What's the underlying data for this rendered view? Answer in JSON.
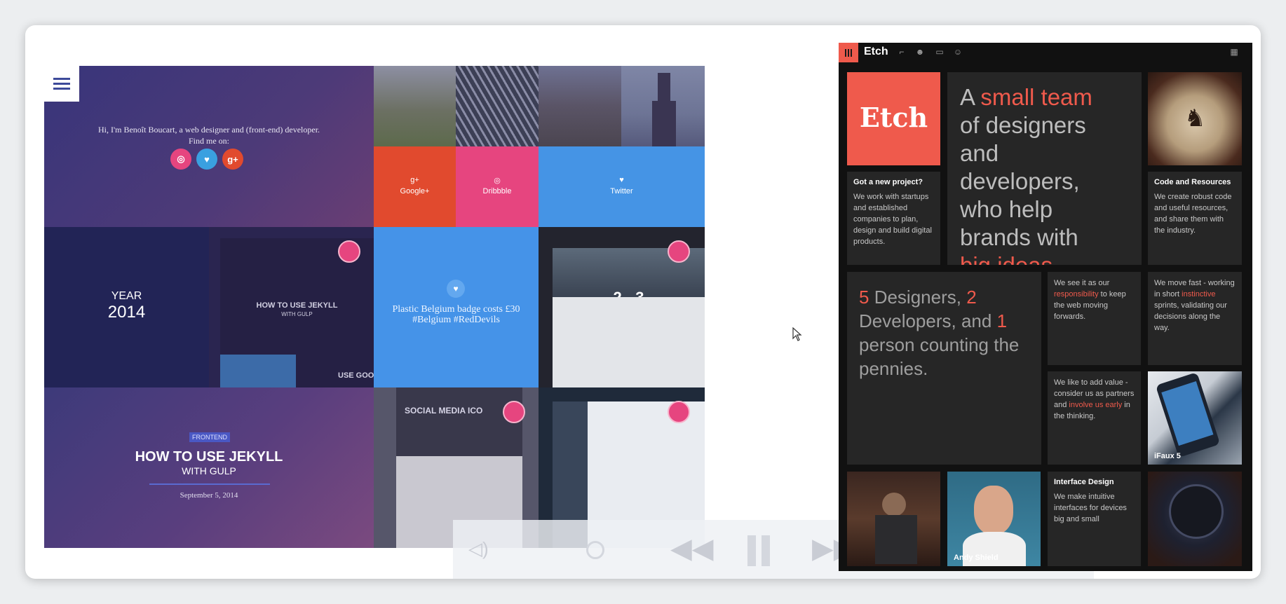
{
  "portfolio": {
    "intro_line1": "Hi, I'm Benoît Boucart, a web designer and (front-end) developer.",
    "intro_line2": "Find me on:",
    "social": [
      {
        "name": "dribbble-icon",
        "glyph": "◎",
        "color": "#e6457f"
      },
      {
        "name": "twitter-icon",
        "glyph": "♥",
        "color": "#3aa0e0"
      },
      {
        "name": "google-plus-icon",
        "glyph": "g+",
        "color": "#e14a2e"
      }
    ],
    "networks": {
      "google": {
        "icon": "g+",
        "label": "Google+"
      },
      "dribbble": {
        "icon": "◎",
        "label": "Dribbble"
      },
      "twitter": {
        "icon": "♥",
        "label": "Twitter"
      }
    },
    "year": {
      "label": "YEAR",
      "value": "2014"
    },
    "shot_title": "HOW TO USE JEKYLL",
    "shot_sub": "WITH GULP",
    "shot_side": "USE GOO",
    "tweet": {
      "icon": "♥",
      "line1": "Plastic Belgium badge costs £30",
      "line2": "#Belgium #RedDevils"
    },
    "score": "2 - 3",
    "post": {
      "badge": "FRONTEND",
      "title": "HOW TO USE JEKYLL",
      "subtitle": "WITH GULP",
      "date": "September 5, 2014"
    },
    "article_title": "SOCIAL MEDIA ICO"
  },
  "etch": {
    "logo_top": "Etch",
    "logo_box": "Etch",
    "topbar_icons": [
      "chair-icon",
      "people-icon",
      "screen-icon",
      "head-icon"
    ],
    "right_icon": "keyboard-icon",
    "hero": {
      "p1": "A ",
      "h1": "small team",
      "p2": " of designers and developers, who help brands with ",
      "h2": "big ideas",
      "p3": "."
    },
    "project": {
      "title": "Got a new project?",
      "text": "We work with startups and established companies to plan, design and build digital products."
    },
    "code": {
      "title": "Code and Resources",
      "text": "We create robust code and useful resources, and share them with the industry."
    },
    "team": {
      "n1": "5",
      "t1": " Designers, ",
      "n2": "2",
      "t2": " Developers, and ",
      "n3": "1",
      "t3": " person counting the pennies."
    },
    "responsibility": {
      "a": "We see it as our ",
      "h": "responsibility",
      "b": " to keep the web moving forwards."
    },
    "fast": {
      "a": "We move fast - working in short ",
      "h": "instinctive",
      "b": " sprints, validating our decisions along the way."
    },
    "value": {
      "a": "We like to add value - consider us as partners and ",
      "h": "involve us early",
      "b": " in the thinking."
    },
    "ifaux": "iFaux 5",
    "andy": "Andy Shield",
    "interface": {
      "title": "Interface Design",
      "text": "We make intuitive interfaces for devices big and small"
    },
    "accent": "#ef5a4c"
  },
  "player": {
    "icons": [
      "volume-icon",
      "dot-icon",
      "rewind-icon",
      "pause-icon",
      "forward-icon"
    ]
  }
}
